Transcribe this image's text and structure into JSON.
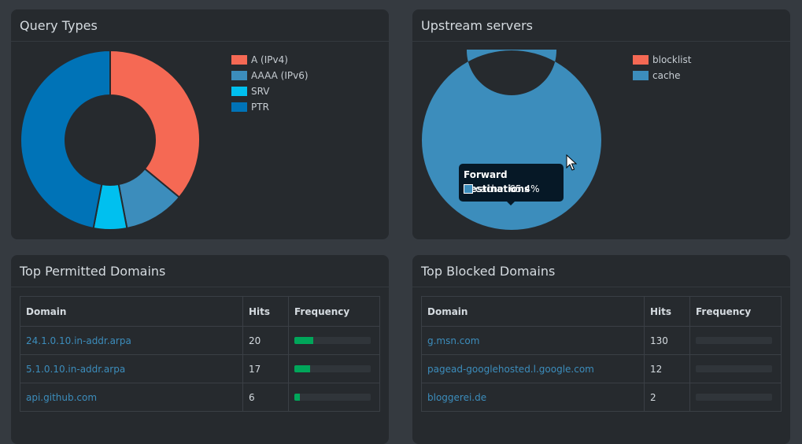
{
  "query_types": {
    "title": "Query Types",
    "legend": [
      {
        "label": "A (IPv4)",
        "color": "#f56954"
      },
      {
        "label": "AAAA (IPv6)",
        "color": "#3c8dbc"
      },
      {
        "label": "SRV",
        "color": "#00c0ef"
      },
      {
        "label": "PTR",
        "color": "#0073b7"
      }
    ]
  },
  "upstream": {
    "title": "Upstream servers",
    "legend": [
      {
        "label": "blocklist",
        "color": "#f56954"
      },
      {
        "label": "cache",
        "color": "#3c8dbc"
      }
    ],
    "tooltip": {
      "title": "Forward destinations",
      "row": "cache: 65.4%"
    }
  },
  "chart_data": [
    {
      "type": "pie",
      "categories": [
        "A (IPv4)",
        "AAAA (IPv6)",
        "SRV",
        "PTR"
      ],
      "values": [
        36,
        11,
        6,
        47
      ],
      "colors": [
        "#f56954",
        "#3c8dbc",
        "#00c0ef",
        "#0073b7"
      ],
      "hole": 0.5
    },
    {
      "type": "pie",
      "categories": [
        "cache"
      ],
      "values": [
        100
      ],
      "colors": [
        "#3c8dbc"
      ],
      "hole": 0.5
    }
  ],
  "permitted": {
    "title": "Top Permitted Domains",
    "headers": [
      "Domain",
      "Hits",
      "Frequency"
    ],
    "rows": [
      {
        "domain": "24.1.0.10.in-addr.arpa",
        "hits": "20",
        "freq": 0.25
      },
      {
        "domain": "5.1.0.10.in-addr.arpa",
        "hits": "17",
        "freq": 0.21
      },
      {
        "domain": "api.github.com",
        "hits": "6",
        "freq": 0.07
      }
    ]
  },
  "blocked": {
    "title": "Top Blocked Domains",
    "headers": [
      "Domain",
      "Hits",
      "Frequency"
    ],
    "rows": [
      {
        "domain": "g.msn.com",
        "hits": "130",
        "freq": 0.0
      },
      {
        "domain": "pagead-googlehosted.l.google.com",
        "hits": "12",
        "freq": 0.0
      },
      {
        "domain": "bloggerei.de",
        "hits": "2",
        "freq": 0.0
      }
    ]
  }
}
